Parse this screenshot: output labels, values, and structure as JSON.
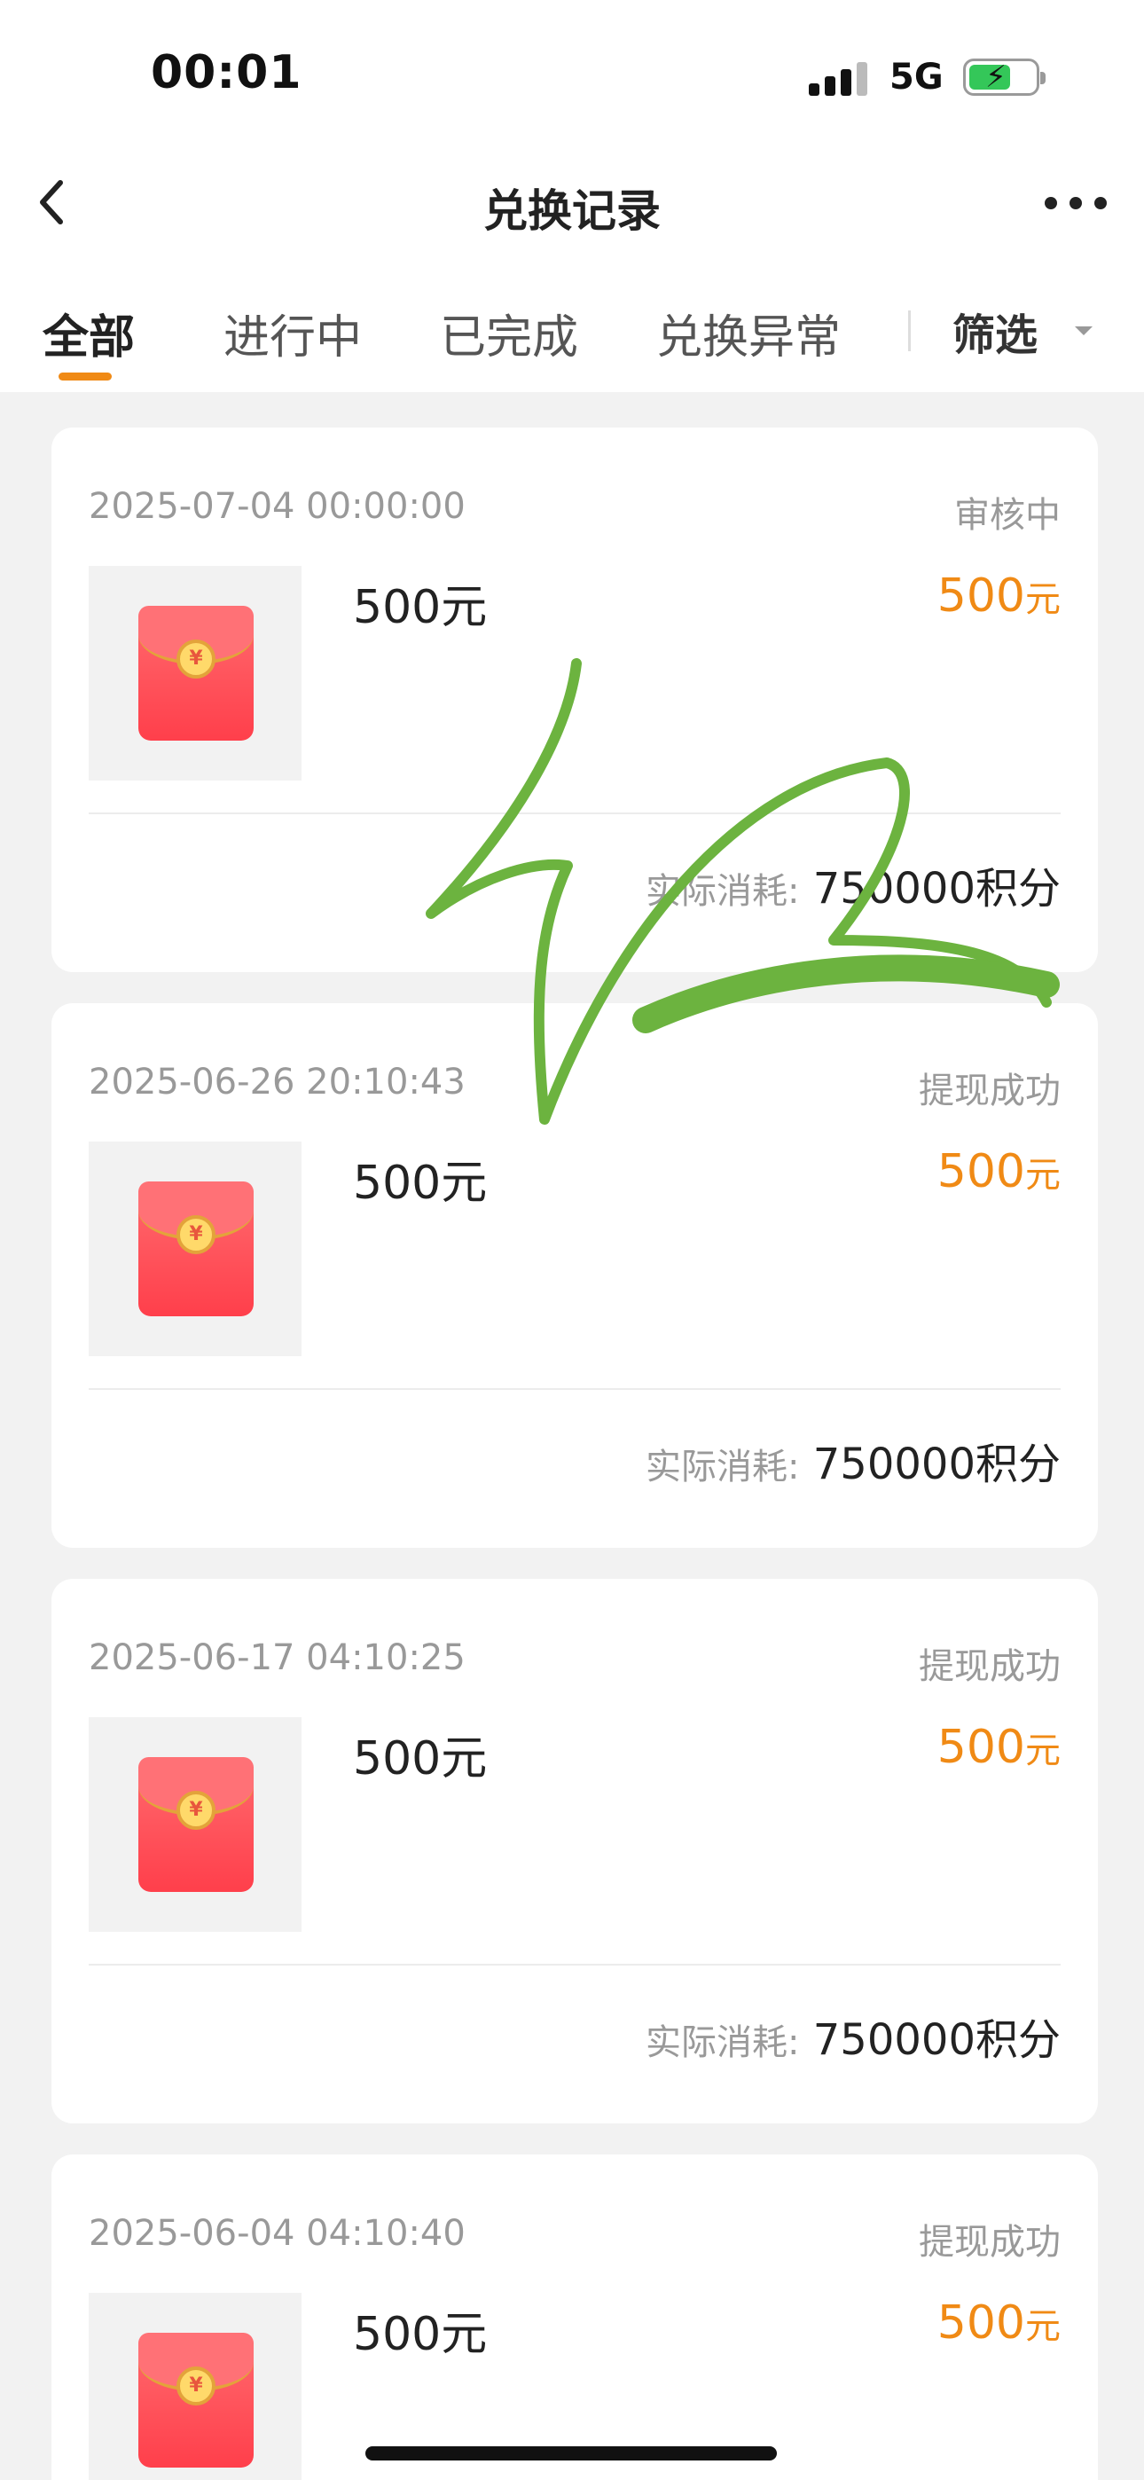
{
  "status_bar": {
    "time": "00:01",
    "network": "5G"
  },
  "nav": {
    "title": "兑换记录"
  },
  "tabs": [
    {
      "label": "全部"
    },
    {
      "label": "进行中"
    },
    {
      "label": "已完成"
    },
    {
      "label": "兑换异常"
    }
  ],
  "filter": {
    "label": "筛选"
  },
  "cards": [
    {
      "date": "2025-07-04 00:00:00",
      "status": "审核中",
      "name": "500元",
      "amount": "500",
      "unit": "元",
      "cost_label": "实际消耗:",
      "cost_value": "750000积分"
    },
    {
      "date": "2025-06-26 20:10:43",
      "status": "提现成功",
      "name": "500元",
      "amount": "500",
      "unit": "元",
      "cost_label": "实际消耗:",
      "cost_value": "750000积分"
    },
    {
      "date": "2025-06-17 04:10:25",
      "status": "提现成功",
      "name": "500元",
      "amount": "500",
      "unit": "元",
      "cost_label": "实际消耗:",
      "cost_value": "750000积分"
    },
    {
      "date": "2025-06-04 04:10:40",
      "status": "提现成功",
      "name": "500元",
      "amount": "500",
      "unit": "元"
    }
  ],
  "colors": {
    "accent": "#f08a15",
    "scribble": "#6cb33f"
  }
}
